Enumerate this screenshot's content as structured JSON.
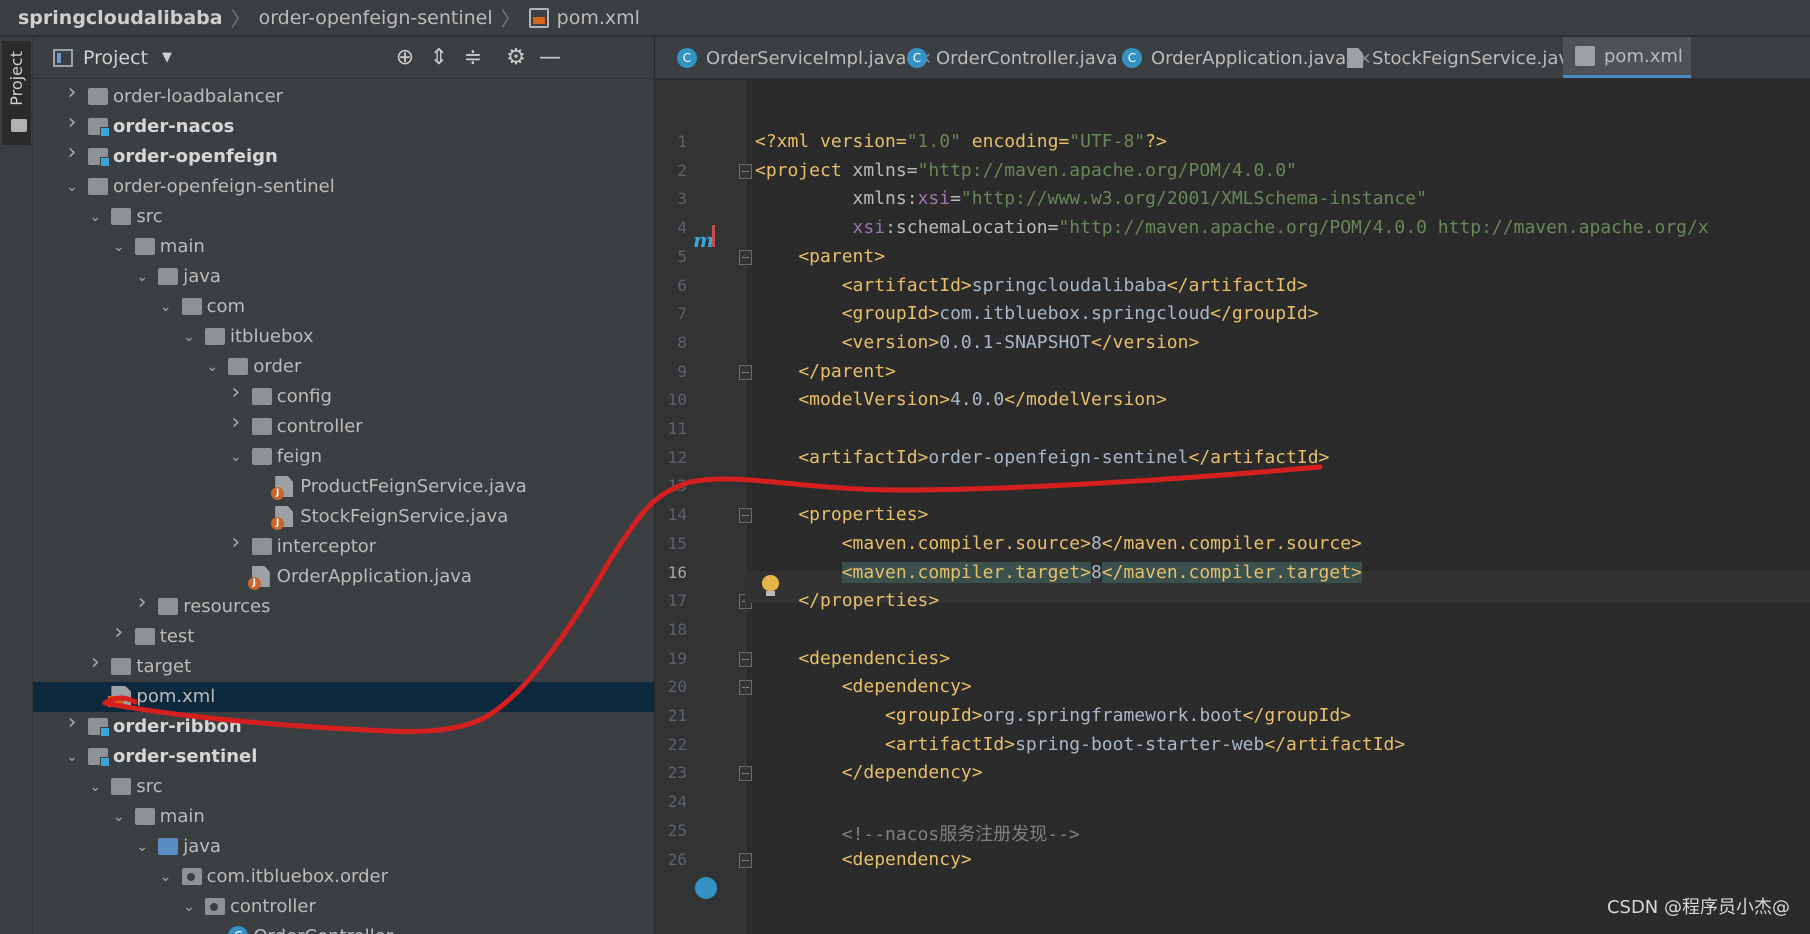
{
  "breadcrumb": {
    "project": "springcloudalibaba",
    "module": "order-openfeign-sentinel",
    "file": "pom.xml"
  },
  "stripe": {
    "label": "Project"
  },
  "project_panel": {
    "title": "Project",
    "tree": [
      {
        "label": "order-loadbalancer",
        "depth": 0,
        "arrow": "right",
        "icon": "folder"
      },
      {
        "label": "order-nacos",
        "depth": 0,
        "arrow": "right",
        "icon": "module",
        "bold": true
      },
      {
        "label": "order-openfeign",
        "depth": 0,
        "arrow": "right",
        "icon": "module",
        "bold": true
      },
      {
        "label": "order-openfeign-sentinel",
        "depth": 0,
        "arrow": "down",
        "icon": "folder"
      },
      {
        "label": "src",
        "depth": 1,
        "arrow": "down",
        "icon": "folder"
      },
      {
        "label": "main",
        "depth": 2,
        "arrow": "down",
        "icon": "folder"
      },
      {
        "label": "java",
        "depth": 3,
        "arrow": "down",
        "icon": "folder"
      },
      {
        "label": "com",
        "depth": 4,
        "arrow": "down",
        "icon": "folder"
      },
      {
        "label": "itbluebox",
        "depth": 5,
        "arrow": "down",
        "icon": "folder"
      },
      {
        "label": "order",
        "depth": 6,
        "arrow": "down",
        "icon": "folder"
      },
      {
        "label": "config",
        "depth": 7,
        "arrow": "right",
        "icon": "folder"
      },
      {
        "label": "controller",
        "depth": 7,
        "arrow": "right",
        "icon": "folder"
      },
      {
        "label": "feign",
        "depth": 7,
        "arrow": "down",
        "icon": "folder"
      },
      {
        "label": "ProductFeignService.java",
        "depth": 8,
        "arrow": "",
        "icon": "jfile"
      },
      {
        "label": "StockFeignService.java",
        "depth": 8,
        "arrow": "",
        "icon": "jfile"
      },
      {
        "label": "interceptor",
        "depth": 7,
        "arrow": "right",
        "icon": "folder"
      },
      {
        "label": "OrderApplication.java",
        "depth": 7,
        "arrow": "",
        "icon": "jfile"
      },
      {
        "label": "resources",
        "depth": 3,
        "arrow": "right",
        "icon": "folder"
      },
      {
        "label": "test",
        "depth": 2,
        "arrow": "right",
        "icon": "folder"
      },
      {
        "label": "target",
        "depth": 1,
        "arrow": "right",
        "icon": "folder"
      },
      {
        "label": "pom.xml",
        "depth": 1,
        "arrow": "",
        "icon": "xml",
        "selected": true
      },
      {
        "label": "order-ribbon",
        "depth": 0,
        "arrow": "right",
        "icon": "module",
        "bold": true
      },
      {
        "label": "order-sentinel",
        "depth": 0,
        "arrow": "down",
        "icon": "module",
        "bold": true
      },
      {
        "label": "src",
        "depth": 1,
        "arrow": "down",
        "icon": "folder"
      },
      {
        "label": "main",
        "depth": 2,
        "arrow": "down",
        "icon": "folder"
      },
      {
        "label": "java",
        "depth": 3,
        "arrow": "down",
        "icon": "folderblue"
      },
      {
        "label": "com.itbluebox.order",
        "depth": 4,
        "arrow": "down",
        "icon": "pkg"
      },
      {
        "label": "controller",
        "depth": 5,
        "arrow": "down",
        "icon": "pkg"
      },
      {
        "label": "OrderController",
        "depth": 6,
        "arrow": "",
        "icon": "class"
      }
    ]
  },
  "tabs": [
    {
      "label": "OrderServiceImpl.java",
      "icon": "class-icon",
      "active": false
    },
    {
      "label": "OrderController.java",
      "icon": "class-icon",
      "active": false
    },
    {
      "label": "OrderApplication.java",
      "icon": "app-class-icon",
      "active": false
    },
    {
      "label": "StockFeignService.java",
      "icon": "java-file-icon",
      "active": false
    },
    {
      "label": "pom.xml",
      "icon": "xml-file-icon",
      "active": true
    }
  ],
  "editor": {
    "current_line": 16,
    "lines": [
      [
        [
          "tg",
          "<?xml version="
        ],
        [
          "av",
          "\"1.0\""
        ],
        [
          "tg",
          " encoding="
        ],
        [
          "av",
          "\"UTF-8\""
        ],
        [
          "tg",
          "?>"
        ]
      ],
      [
        [
          "tg",
          "<project "
        ],
        [
          "at",
          "xmlns="
        ],
        [
          "av",
          "\"http://maven.apache.org/POM/4.0.0\""
        ]
      ],
      [
        [
          "at",
          "         xmlns:"
        ],
        [
          "ns",
          "xsi"
        ],
        [
          "at",
          "="
        ],
        [
          "av",
          "\"http://www.w3.org/2001/XMLSchema-instance\""
        ]
      ],
      [
        [
          "at",
          "         "
        ],
        [
          "ns",
          "xsi"
        ],
        [
          "at",
          ":schemaLocation="
        ],
        [
          "av",
          "\"http://maven.apache.org/POM/4.0.0 http://maven.apache.org/x"
        ]
      ],
      [
        [
          "tg",
          "    <parent>"
        ]
      ],
      [
        [
          "tg",
          "        <artifactId>"
        ],
        [
          "t",
          "springcloudalibaba"
        ],
        [
          "tg",
          "</artifactId>"
        ]
      ],
      [
        [
          "tg",
          "        <groupId>"
        ],
        [
          "t",
          "com.itbluebox.springcloud"
        ],
        [
          "tg",
          "</groupId>"
        ]
      ],
      [
        [
          "tg",
          "        <version>"
        ],
        [
          "t",
          "0.0.1-SNAPSHOT"
        ],
        [
          "tg",
          "</version>"
        ]
      ],
      [
        [
          "tg",
          "    </parent>"
        ]
      ],
      [
        [
          "tg",
          "    <modelVersion>"
        ],
        [
          "t",
          "4.0.0"
        ],
        [
          "tg",
          "</modelVersion>"
        ]
      ],
      [],
      [
        [
          "tg",
          "    <artifactId>"
        ],
        [
          "t",
          "order-openfeign-sentinel"
        ],
        [
          "tg",
          "</artifactId>"
        ]
      ],
      [],
      [
        [
          "tg",
          "    <properties>"
        ]
      ],
      [
        [
          "tg",
          "        <maven.compiler.source>"
        ],
        [
          "t",
          "8"
        ],
        [
          "tg",
          "</maven.compiler.source>"
        ]
      ],
      [
        [
          "t",
          "        "
        ],
        [
          "tghl",
          "<maven.compiler.target>"
        ],
        [
          "t",
          "8"
        ],
        [
          "tghl",
          "</maven.compiler.target>"
        ]
      ],
      [
        [
          "tg",
          "    </properties>"
        ]
      ],
      [],
      [
        [
          "tg",
          "    <dependencies>"
        ]
      ],
      [
        [
          "tg",
          "        <dependency>"
        ]
      ],
      [
        [
          "tg",
          "            <groupId>"
        ],
        [
          "t",
          "org.springframework.boot"
        ],
        [
          "tg",
          "</groupId>"
        ]
      ],
      [
        [
          "tg",
          "            <artifactId>"
        ],
        [
          "t",
          "spring-boot-starter-web"
        ],
        [
          "tg",
          "</artifactId>"
        ]
      ],
      [
        [
          "tg",
          "        </dependency>"
        ]
      ],
      [],
      [
        [
          "cm",
          "        <!--nacos服务注册发现-->"
        ]
      ],
      [
        [
          "tg",
          "        <dependency>"
        ]
      ]
    ]
  },
  "watermark": "CSDN @程序员小杰@",
  "colors": {
    "annotation": "#d62020",
    "selection": "#0d293e",
    "tab_underline": "#4a88c7"
  }
}
